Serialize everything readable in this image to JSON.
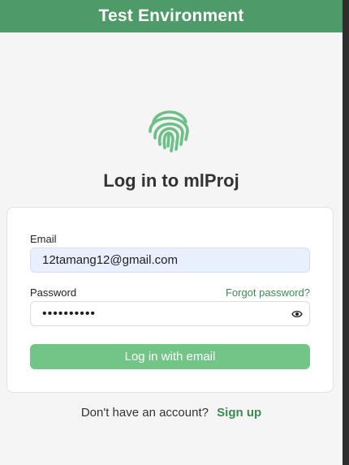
{
  "banner": {
    "title": "Test Environment"
  },
  "login": {
    "heading": "Log in to mlProj"
  },
  "form": {
    "email_label": "Email",
    "email_value": "12tamang12@gmail.com",
    "password_label": "Password",
    "password_value": "••••••••••",
    "forgot_password": "Forgot password?",
    "submit_label": "Log in with email"
  },
  "signup": {
    "prompt": "Don't have an account?",
    "link": "Sign up"
  },
  "icons": {
    "logo": "fingerprint-icon",
    "password_toggle": "eye-icon"
  },
  "colors": {
    "brand": "#4e9a68",
    "button": "#72c487",
    "link": "#3d8a55",
    "email_fill": "#e8f0fe"
  }
}
